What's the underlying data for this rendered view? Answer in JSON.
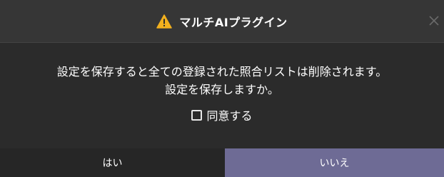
{
  "dialog": {
    "title": "マルチAIプラグイン",
    "warning_icon": "warning-triangle-icon",
    "close_icon": "close-icon",
    "message_line1": "設定を保存すると全ての登録された照合リストは削除されます。",
    "message_line2": "設定を保存しますか。",
    "agree_checkbox": {
      "label": "同意する",
      "checked": false
    },
    "buttons": {
      "yes": "はい",
      "no": "いいえ"
    },
    "colors": {
      "background": "#2b2b2b",
      "titlebar": "#363636",
      "warning": "#f2b01e",
      "yes_button": "#262626",
      "no_button": "#6e6b95"
    }
  }
}
